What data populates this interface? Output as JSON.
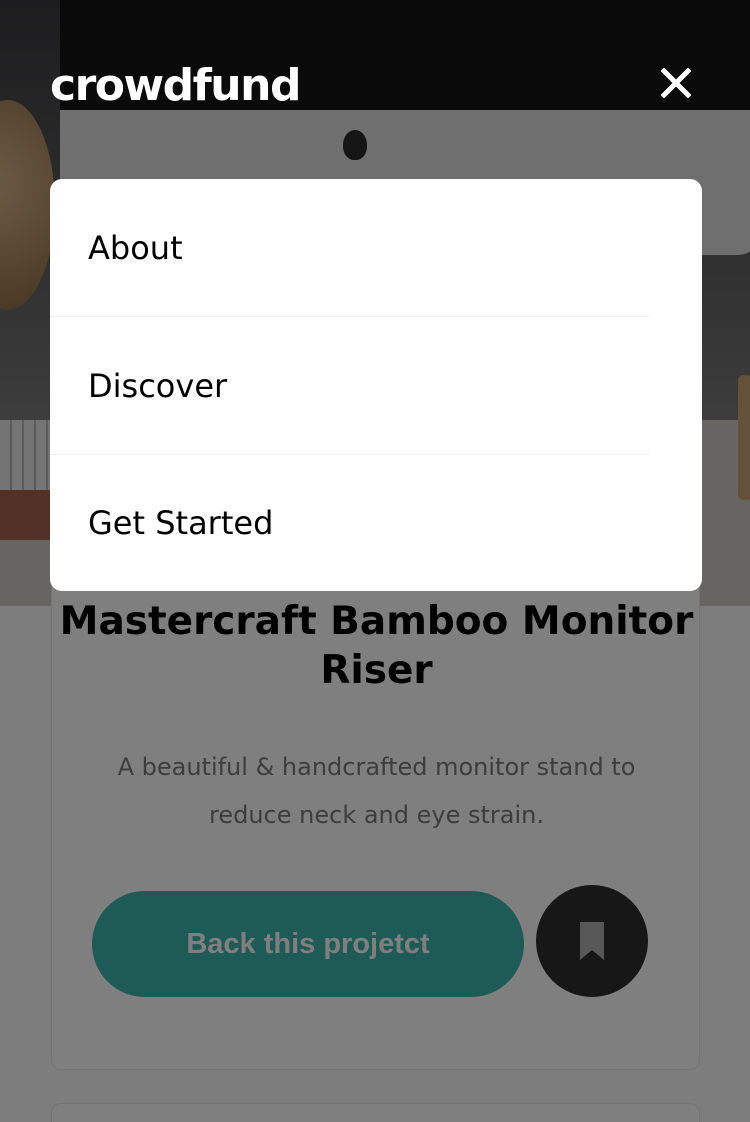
{
  "brand": {
    "logo_text": "crowdfund"
  },
  "header": {
    "close_icon": "close-icon"
  },
  "menu": {
    "items": [
      {
        "label": "About"
      },
      {
        "label": "Discover"
      },
      {
        "label": "Get Started"
      }
    ]
  },
  "project": {
    "title": "Mastercraft Bamboo Monitor Riser",
    "description": "A beautiful & handcrafted monitor stand to reduce neck and eye strain.",
    "back_button_label": "Back this projetct",
    "bookmark_icon": "bookmark-icon"
  },
  "colors": {
    "accent": "#3cb4ac",
    "dark": "#2f2f2f",
    "overlay": "rgba(0,0,0,0.5)"
  }
}
